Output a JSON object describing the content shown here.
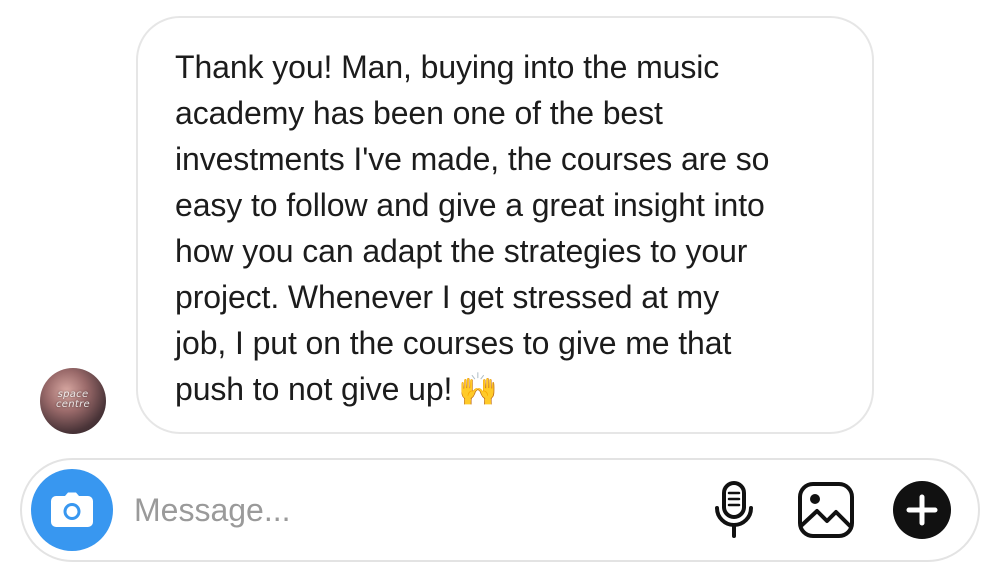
{
  "conversation": {
    "message": {
      "text": "Thank you! Man, buying into the music\nacademy has been one of the best\ninvestments I've made, the courses are so\neasy to follow and give a great insight into\nhow you can adapt the strategies to your\nproject. Whenever I get stressed at my\njob, I put on the courses to give me that\npush to not give up!",
      "emoji": "🙌"
    },
    "avatar": {
      "caption": "space centre"
    }
  },
  "composer": {
    "placeholder": "Message...",
    "value": "",
    "icons": {
      "camera": "camera-icon",
      "microphone": "microphone-icon",
      "gallery": "gallery-icon",
      "add": "plus-circle-icon"
    }
  },
  "colors": {
    "accent": "#3897f0",
    "bubble_border": "#e6e6e6",
    "text": "#1c1c1c",
    "placeholder": "#9a9a9a",
    "icon": "#111111"
  }
}
